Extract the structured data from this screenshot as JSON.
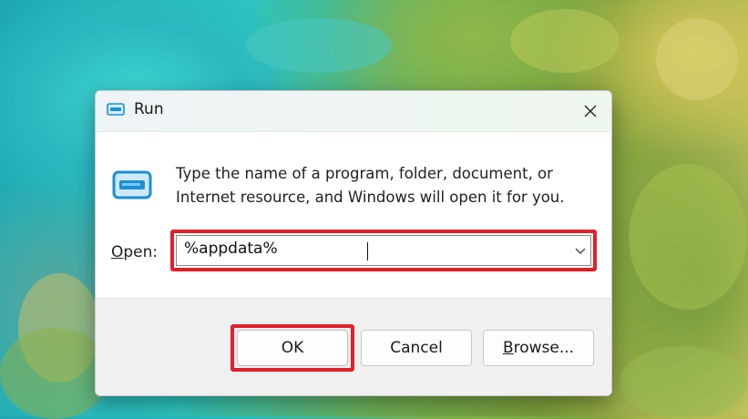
{
  "dialog": {
    "title": "Run",
    "description_line1": "Type the name of a program, folder, document, or",
    "description_line2": "Internet resource, and Windows will open it for you.",
    "open_label_accel": "O",
    "open_label_rest": "pen:",
    "open_value": "%appdata%",
    "buttons": {
      "ok": "OK",
      "cancel": "Cancel",
      "browse_accel": "B",
      "browse_rest": "rowse..."
    }
  },
  "icons": {
    "title": "run-app-icon",
    "large": "run-app-icon",
    "close": "close-icon",
    "dropdown": "chevron-down-icon"
  },
  "colors": {
    "highlight": "#e0202a",
    "icon_blue": "#1b8fd6"
  }
}
